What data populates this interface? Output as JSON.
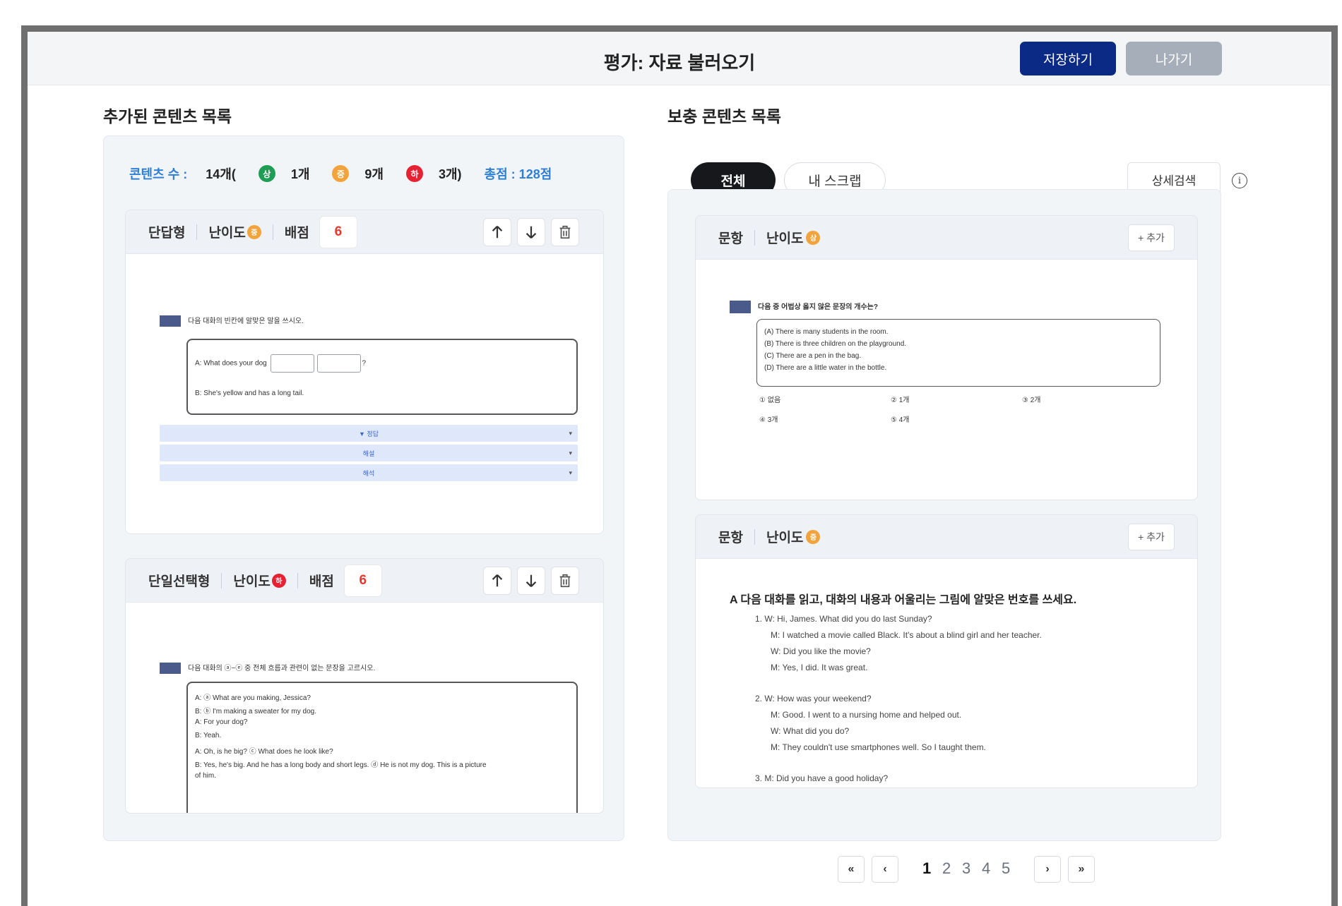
{
  "header": {
    "title": "평가: 자료 불러오기",
    "save_label": "저장하기",
    "exit_label": "나가기"
  },
  "left": {
    "section_title": "추가된 콘텐츠 목록",
    "summary": {
      "count_label": "콘텐츠 수 :",
      "count_total": "14개(",
      "high_badge": "상",
      "high_count": "1개",
      "mid_badge": "중",
      "mid_count": "9개",
      "low_badge": "하",
      "low_count": "3개)",
      "total_label": "총점 : 128점"
    },
    "cards": [
      {
        "type": "단답형",
        "difficulty_label": "난이도",
        "difficulty_badge": "중",
        "score_label": "배점",
        "score": "6",
        "question_num": "2",
        "question_text": "다음 대화의 빈칸에 알맞은 말을 쓰시오.",
        "line_a": "A: What does your dog",
        "line_a_end": "?",
        "line_b": "B: She's yellow and has a long tail.",
        "hints": [
          "▼ 정답",
          "해설",
          "해석"
        ]
      },
      {
        "type": "단일선택형",
        "difficulty_label": "난이도",
        "difficulty_badge": "하",
        "score_label": "배점",
        "score": "6",
        "question_num": "3",
        "question_text": "다음 대화의 ⓐ~ⓔ 중 전체 흐름과 관련이 없는 문장을 고르시오.",
        "lines": [
          "A: ⓐ What are you making, Jessica?",
          "B: ⓑ I'm making a sweater for my dog.",
          "A: For your dog?",
          "B: Yeah.",
          "A: Oh, is he big? ⓒ What does he look like?",
          "B: Yes, he's big. And he has a long body and short legs. ⓓ He is not my dog. This is a picture",
          "of him."
        ]
      }
    ]
  },
  "right": {
    "section_title": "보충 콘텐츠 목록",
    "tab_all": "전체",
    "tab_scrap": "내 스크랩",
    "detail_search": "상세검색",
    "info_icon": "i",
    "cards": [
      {
        "type": "문항",
        "difficulty_label": "난이도",
        "difficulty_badge": "상",
        "add_label": "+ 추가",
        "question_text": "다음 중 어법상 옳지 않은 문장의 개수는?",
        "options_box": [
          "(A) There is many students in the room.",
          "(B) There is three children on the playground.",
          "(C) There are a pen in the bag.",
          "(D) There are a little water in the bottle."
        ],
        "choices": [
          "① 없음",
          "② 1개",
          "③ 2개",
          "④ 3개",
          "⑤ 4개"
        ]
      },
      {
        "type": "문항",
        "difficulty_label": "난이도",
        "difficulty_badge": "중",
        "add_label": "+ 추가",
        "question_text": "A 다음 대화를 읽고, 대화의 내용과 어울리는 그림에 알맞은 번호를 쓰세요.",
        "lines": [
          "1. W:  Hi, James. What did you do last Sunday?",
          "M:  I watched a movie called Black. It's about a blind girl and her teacher.",
          "W:  Did you like the movie?",
          "M:  Yes, I did. It was great.",
          "2. W:  How was your weekend?",
          "M:  Good. I went to a nursing home and helped out.",
          "W:  What did you do?",
          "M:  They couldn't use smartphones well. So I taught them.",
          "3. M:  Did you have a good holiday?"
        ]
      }
    ]
  },
  "pagination": {
    "first": "«",
    "prev": "‹",
    "pages": [
      "1",
      "2",
      "3",
      "4",
      "5"
    ],
    "current": "1",
    "next": "›",
    "last": "»"
  }
}
